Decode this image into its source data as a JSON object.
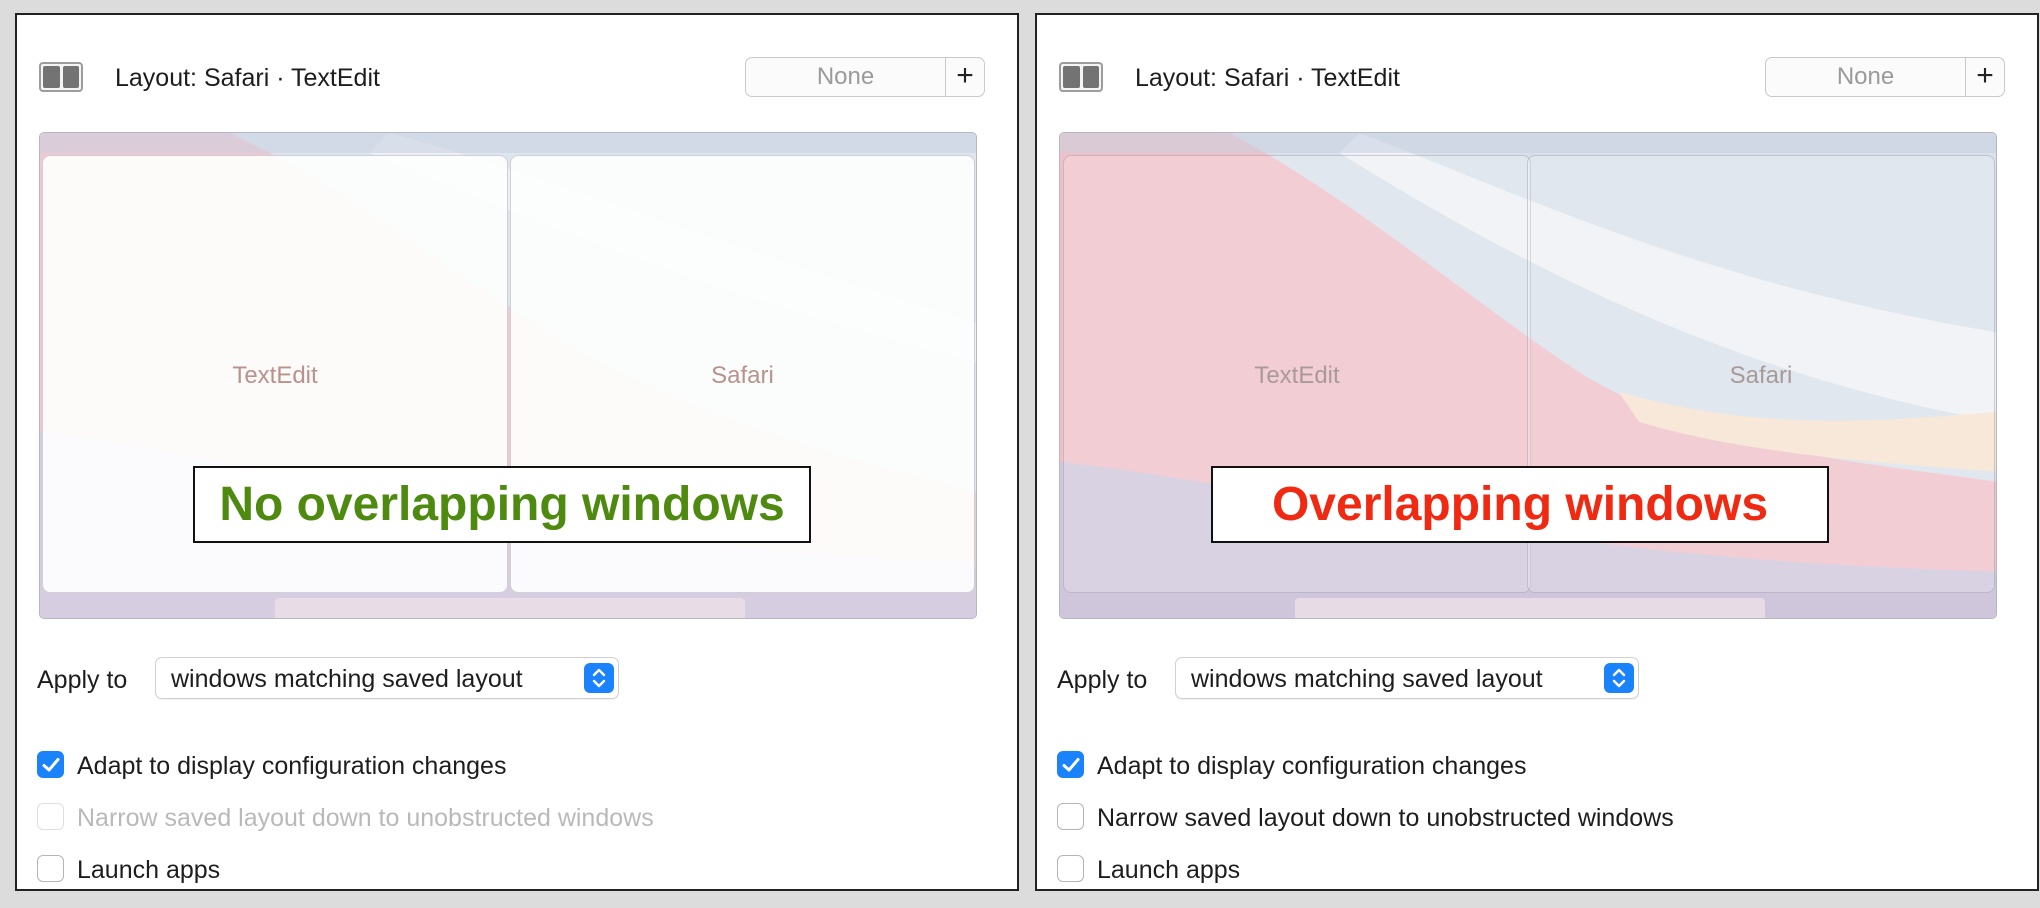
{
  "colors": {
    "accent": "#1a82fb",
    "no_overlap_text": "#4f8a10",
    "overlap_text": "#f02a12"
  },
  "panels": [
    {
      "layout_icon": "two-pane-layout-icon",
      "layout_title": "Layout: Safari · TextEdit",
      "shortcut_value": "None",
      "shortcut_add": "+",
      "windows": {
        "left": "TextEdit",
        "right": "Safari"
      },
      "callout": "No overlapping windows",
      "apply_label": "Apply to",
      "apply_value": "windows matching saved layout",
      "options": {
        "adapt": {
          "label": "Adapt to display configuration changes",
          "checked": true,
          "enabled": true
        },
        "narrow": {
          "label": "Narrow saved layout down to unobstructed windows",
          "checked": false,
          "enabled": false
        },
        "launch": {
          "label": "Launch apps",
          "checked": false,
          "enabled": true
        }
      }
    },
    {
      "layout_icon": "two-pane-layout-icon",
      "layout_title": "Layout: Safari · TextEdit",
      "shortcut_value": "None",
      "shortcut_add": "+",
      "windows": {
        "left": "TextEdit",
        "right": "Safari"
      },
      "callout": "Overlapping windows",
      "apply_label": "Apply to",
      "apply_value": "windows matching saved layout",
      "options": {
        "adapt": {
          "label": "Adapt to display configuration changes",
          "checked": true,
          "enabled": true
        },
        "narrow": {
          "label": "Narrow saved layout down to unobstructed windows",
          "checked": false,
          "enabled": true
        },
        "launch": {
          "label": "Launch apps",
          "checked": false,
          "enabled": true
        }
      }
    }
  ]
}
